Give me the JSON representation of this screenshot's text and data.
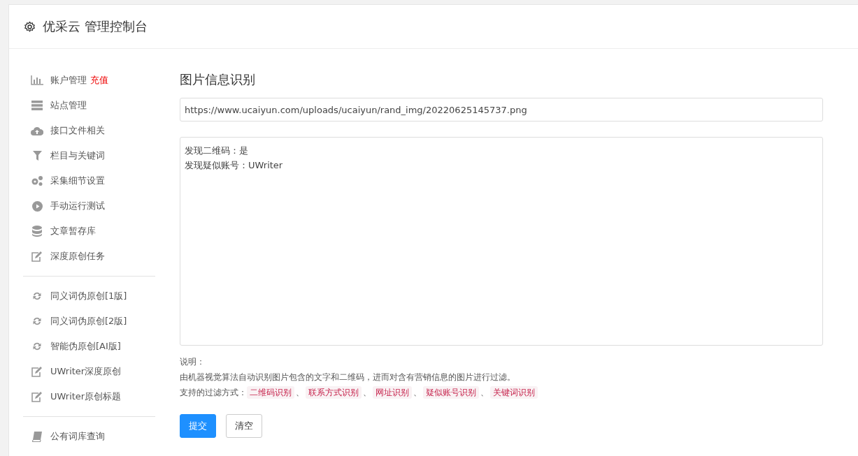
{
  "header": {
    "title": "优采云 管理控制台"
  },
  "sidebar": {
    "groups": [
      {
        "items": [
          {
            "kind": "chart",
            "label": "账户管理",
            "badge": "充值"
          },
          {
            "kind": "server",
            "label": "站点管理"
          },
          {
            "kind": "cloud",
            "label": "接口文件相关"
          },
          {
            "kind": "filter",
            "label": "栏目与关键词"
          },
          {
            "kind": "gears",
            "label": "采集细节设置"
          },
          {
            "kind": "play",
            "label": "手动运行测试"
          },
          {
            "kind": "database",
            "label": "文章暂存库"
          },
          {
            "kind": "edit",
            "label": "深度原创任务"
          }
        ]
      },
      {
        "items": [
          {
            "kind": "refresh",
            "label": "同义词伪原创[1版]"
          },
          {
            "kind": "refresh",
            "label": "同义词伪原创[2版]"
          },
          {
            "kind": "refresh",
            "label": "智能伪原创[AI版]"
          },
          {
            "kind": "edit",
            "label": "UWriter深度原创"
          },
          {
            "kind": "edit",
            "label": "UWriter原创标题"
          }
        ]
      },
      {
        "items": [
          {
            "kind": "book",
            "label": "公有词库查询"
          }
        ]
      }
    ]
  },
  "main": {
    "title": "图片信息识别",
    "url_field": {
      "value": "https://www.ucaiyun.com/uploads/ucaiyun/rand_img/20220625145737.png"
    },
    "result_box": {
      "lines": [
        "发现二维码：是",
        "发现疑似账号：UWriter"
      ]
    },
    "note_label": "说明：",
    "note_text": "由机器视觉算法自动识别图片包含的文字和二维码，进而对含有营销信息的图片进行过滤。",
    "filters_label": "支持的过滤方式：",
    "filters": [
      "二维码识别",
      "联系方式识别",
      "网址识别",
      "疑似账号识别",
      "关键词识别"
    ],
    "separator": "、",
    "buttons": [
      {
        "label": "提交",
        "kind": "primary"
      },
      {
        "label": "清空",
        "kind": "default"
      }
    ]
  }
}
